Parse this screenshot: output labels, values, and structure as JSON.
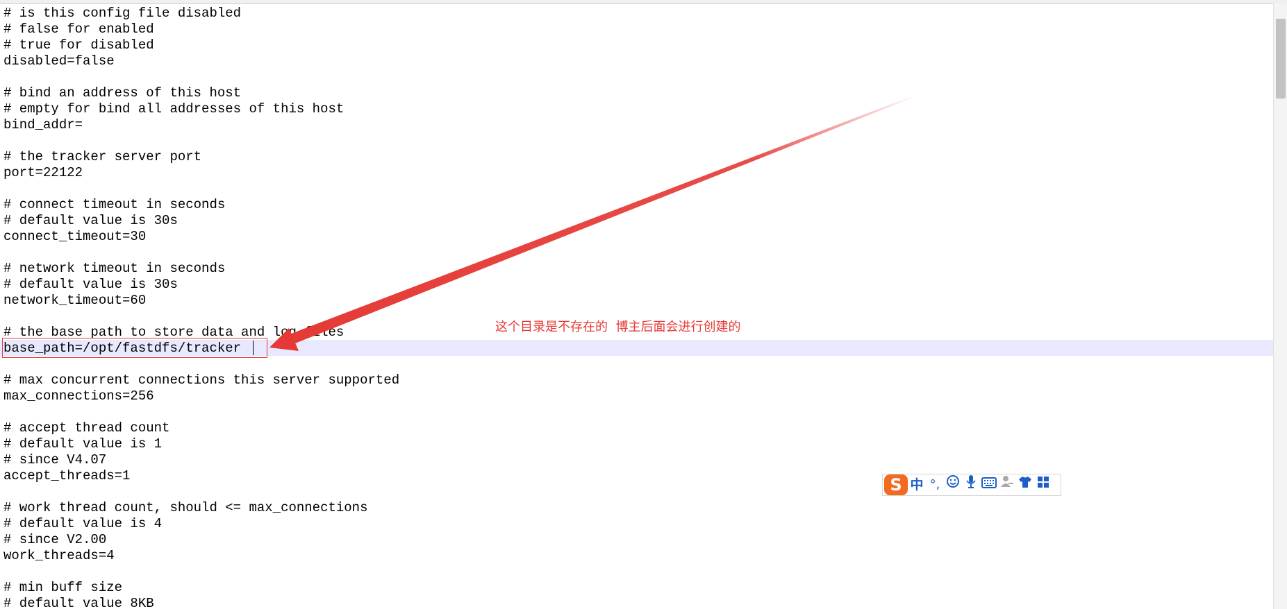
{
  "editor": {
    "lines": [
      "# is this config file disabled",
      "# false for enabled",
      "# true for disabled",
      "disabled=false",
      "",
      "# bind an address of this host",
      "# empty for bind all addresses of this host",
      "bind_addr=",
      "",
      "# the tracker server port",
      "port=22122",
      "",
      "# connect timeout in seconds",
      "# default value is 30s",
      "connect_timeout=30",
      "",
      "# network timeout in seconds",
      "# default value is 30s",
      "network_timeout=60",
      "",
      "# the base path to store data and log files",
      "base_path=/opt/fastdfs/tracker",
      "",
      "# max concurrent connections this server supported",
      "max_connections=256",
      "",
      "# accept thread count",
      "# default value is 1",
      "# since V4.07",
      "accept_threads=1",
      "",
      "# work thread count, should <= max_connections",
      "# default value is 4",
      "# since V2.00",
      "work_threads=4",
      "",
      "# min buff size",
      "# default value 8KB"
    ],
    "current_line_index": 21
  },
  "annotation": {
    "text": "这个目录是不存在的  博主后面会进行创建的",
    "color": "#e53935"
  },
  "ime_toolbar": {
    "logo": "S",
    "language": "中",
    "punctuation": "°,",
    "icons": [
      "smiley-icon",
      "microphone-icon",
      "keyboard-icon",
      "user-skin-icon",
      "tshirt-icon",
      "grid-menu-icon"
    ]
  }
}
